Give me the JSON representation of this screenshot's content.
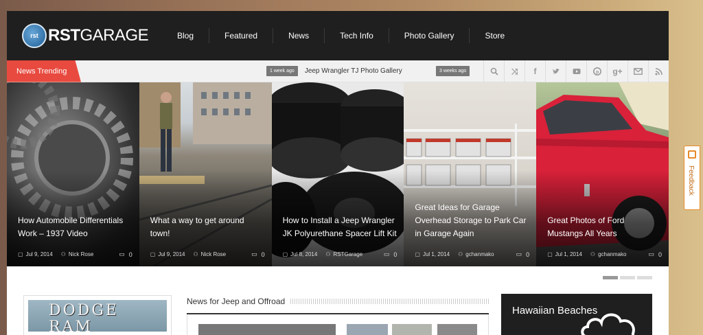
{
  "logo": {
    "badge": "rst",
    "bold": "RST",
    "light": "GARAGE"
  },
  "nav": [
    "Blog",
    "Featured",
    "News",
    "Tech Info",
    "Photo Gallery",
    "Store"
  ],
  "trending": {
    "label": "News Trending",
    "items": [
      {
        "tag": "1 week ago",
        "title": "Jeep Wrangler TJ Photo Gallery"
      },
      {
        "tag": "3 weeks ago",
        "title": ""
      }
    ]
  },
  "social_icons": [
    "search-icon",
    "shuffle-icon",
    "facebook-icon",
    "twitter-icon",
    "youtube-icon",
    "pinterest-icon",
    "google-plus-icon",
    "email-icon",
    "rss-icon"
  ],
  "slides": [
    {
      "title": "How Automobile Differentials Work – 1937 Video",
      "date": "Jul 9, 2014",
      "author": "Nick Rose",
      "comments": "0"
    },
    {
      "title": "What a way to get around town!",
      "date": "Jul 9, 2014",
      "author": "Nick Rose",
      "comments": "0"
    },
    {
      "title": "How to Install a Jeep Wrangler JK Polyurethane Spacer Lift Kit",
      "date": "Jul 8, 2014",
      "author": "RSTGarage",
      "comments": "0"
    },
    {
      "title": "Great Ideas for Garage Overhead Storage to Park Car in Garage Again",
      "date": "Jul 1, 2014",
      "author": "gchanmako",
      "comments": "0"
    },
    {
      "title": "Great Photos of Ford Mustangs All Years",
      "date": "Jul 1, 2014",
      "author": "gchanmako",
      "comments": "0"
    }
  ],
  "ad_left": {
    "text": "DODGE RAM"
  },
  "section": {
    "title": "News for Jeep and Offroad"
  },
  "ad_right": {
    "text": "Hawaiian Beaches"
  },
  "feedback": {
    "label": "Feedback"
  }
}
